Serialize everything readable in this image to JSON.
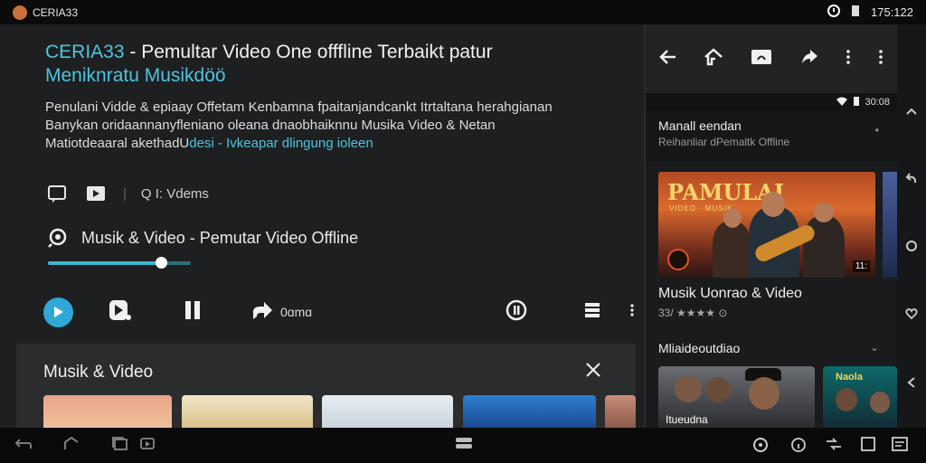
{
  "statusbar": {
    "app_name": "CERIA33",
    "time": "175:122"
  },
  "main": {
    "title_part1": "CERIA33",
    "title_part2": " - Pemultar Video One offfline Terbaikt patur",
    "title_line2": "Meniknratu Musikdöö",
    "desc_line1": "Penulani Vidde & epiaay Offetam Kenbamna fpaitanjandcankt Itrtaltana herahgianan",
    "desc_line2": "Banykan oridaannanyfleniano oleana dnaobhaiknnu Musika Video & Netan",
    "desc_line3_prefix": "Matiotdeaaral akethadU",
    "desc_line3_accent": "desi - Ivkeapar dlingung ioleen",
    "mode_label": "Q I: Vdems",
    "now_playing": "Musik & Video - Pemutar Video Offline",
    "progress": 0.79,
    "speed_label": "0ɑmɑ",
    "icons": [
      "chat-icon",
      "video-icon",
      "search-icon",
      "play-icon",
      "pause-icon",
      "forward-icon",
      "timer-icon",
      "menu-icon",
      "more-icon"
    ],
    "accent_color": "#4ec4dc"
  },
  "panel": {
    "title": "Musik & Video"
  },
  "side": {
    "status": "30:08",
    "section_title": "Manall eendan",
    "section_sub": "Reihanliar dPemaltk Offline",
    "hero_brand": "PAMULAI",
    "hero_sub": "VIDEO · MUSIK",
    "hero_time": "11:",
    "video_title": "Musik Uonrao & Video",
    "video_meta": "33/ ★★★★ ⊙",
    "related_label": "Mliaideoutdiao",
    "rel_thumb1_label": "Itueudna",
    "rel_thumb2_label": "Naola"
  }
}
